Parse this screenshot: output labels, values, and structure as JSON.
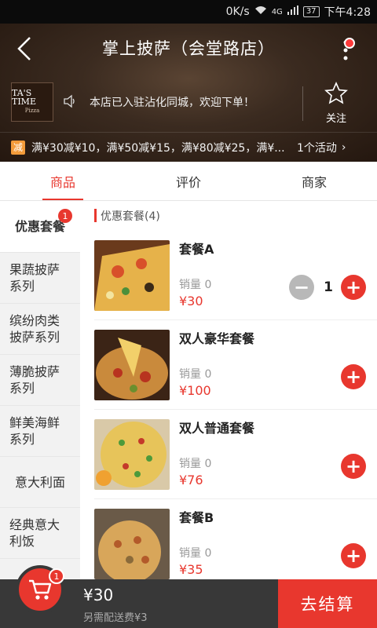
{
  "status_bar": {
    "network": "0K/s",
    "signal": "4G",
    "battery": "37",
    "time": "下午4:28"
  },
  "header": {
    "title": "掌上披萨（会堂路店）",
    "logo_line1": "TA'S TIME",
    "logo_line2": "Pizza",
    "notice": "本店已入驻沾化同城，欢迎下单！",
    "follow_label": "关注",
    "promo_tag": "减",
    "promo_text": "满¥30减¥10，满¥50减¥15，满¥80减¥25，满¥...",
    "promo_count": "1个活动",
    "promo_chevron": "›"
  },
  "tabs": [
    {
      "label": "商品"
    },
    {
      "label": "评价"
    },
    {
      "label": "商家"
    }
  ],
  "sidebar": {
    "items": [
      {
        "label": "优惠套餐",
        "badge": "1"
      },
      {
        "label": "果蔬披萨系列"
      },
      {
        "label": "缤纷肉类披萨系列"
      },
      {
        "label": "薄脆披萨系列"
      },
      {
        "label": "鲜美海鲜系列"
      },
      {
        "label": "意大利面"
      },
      {
        "label": "经典意大利饭"
      }
    ]
  },
  "main": {
    "section_title": "优惠套餐(4)",
    "items": [
      {
        "name": "套餐A",
        "sales": "销量 0",
        "price": "¥30",
        "qty": "1"
      },
      {
        "name": "双人豪华套餐",
        "sales": "销量 0",
        "price": "¥100"
      },
      {
        "name": "双人普通套餐",
        "sales": "销量 0",
        "price": "¥76"
      },
      {
        "name": "套餐B",
        "sales": "销量 0",
        "price": "¥35"
      }
    ]
  },
  "cart": {
    "badge": "1",
    "total": "¥30",
    "delivery": "另需配送费¥3",
    "checkout_label": "去结算"
  },
  "colors": {
    "accent": "#e8372e",
    "bottom_bar": "#383838"
  }
}
